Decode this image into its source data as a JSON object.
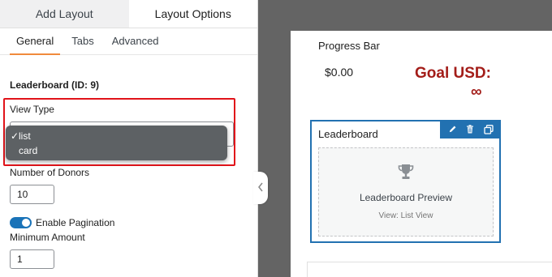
{
  "panel": {
    "tabs": [
      {
        "label": "Add Layout"
      },
      {
        "label": "Layout Options"
      }
    ],
    "sub_tabs": [
      {
        "label": "General"
      },
      {
        "label": "Tabs"
      },
      {
        "label": "Advanced"
      }
    ],
    "section_title": "Leaderboard (ID: 9)",
    "view_type": {
      "label": "View Type",
      "options": [
        {
          "label": "list",
          "checked": "✓"
        },
        {
          "label": "card",
          "checked": ""
        }
      ]
    },
    "number_of_donors": {
      "label": "Number of Donors",
      "value": "10"
    },
    "pagination": {
      "label": "Enable Pagination",
      "enabled": true
    },
    "minimum_amount": {
      "label": "Minimum Amount",
      "value": "1"
    }
  },
  "canvas": {
    "progress_bar": {
      "title": "Progress Bar",
      "amount": "$0.00",
      "goal": "Goal USD:",
      "goal_value": "∞"
    },
    "leaderboard": {
      "title": "Leaderboard",
      "preview_title": "Leaderboard Preview",
      "preview_sub": "View: List View",
      "toolbar_icons": [
        "pencil-icon",
        "trash-icon",
        "duplicate-icon"
      ]
    }
  },
  "colors": {
    "accent": "#2271b1",
    "highlight": "#e1131a",
    "goal": "#a31d19",
    "tab_underline": "#f08a3c"
  }
}
